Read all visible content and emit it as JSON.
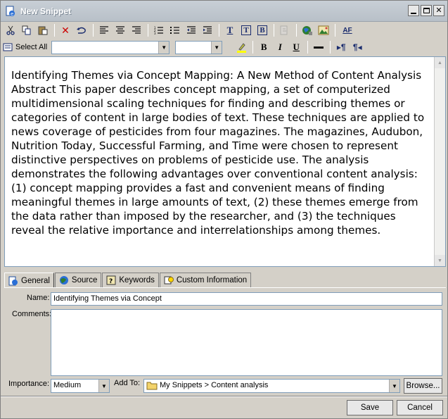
{
  "window": {
    "title": "New Snippet"
  },
  "toolbar2": {
    "select_all_label": "Select All",
    "font_value": "",
    "size_value": ""
  },
  "content": {
    "text": "Identifying Themes via Concept Mapping: A New Method of Content Analysis Abstract This paper describes concept mapping, a set of computerized multidimensional scaling techniques for finding and describing themes or categories of content in large bodies of text. These techniques are applied to news coverage of pesticides from four magazines. The magazines, Audubon, Nutrition Today, Successful Farming, and Time were chosen to represent distinctive perspectives on problems of pesticide use. The analysis demonstrates the following advantages over conventional content analysis: (1) concept mapping provides a fast and convenient means of finding meaningful themes in large amounts of text, (2) these themes emerge from the data rather than imposed by the researcher, and (3) the techniques reveal the relative importance and interrelationships among themes."
  },
  "tabs": [
    {
      "label": "General",
      "icon": "info-icon",
      "active": true
    },
    {
      "label": "Source",
      "icon": "globe-icon"
    },
    {
      "label": "Keywords",
      "icon": "keywords-icon"
    },
    {
      "label": "Custom Information",
      "icon": "bulb-icon"
    }
  ],
  "form": {
    "name_label": "Name:",
    "name_value": "Identifying Themes via Concept",
    "comments_label": "Comments:",
    "comments_value": "",
    "importance_label": "Importance:",
    "importance_value": "Medium",
    "addto_label": "Add To:",
    "addto_value": "My Snippets > Content analysis",
    "browse_label": "Browse..."
  },
  "buttons": {
    "save": "Save",
    "cancel": "Cancel"
  },
  "colors": {
    "title_text": "#ffffff",
    "red_x": "#cc0000",
    "highlight": "#ffff00"
  }
}
